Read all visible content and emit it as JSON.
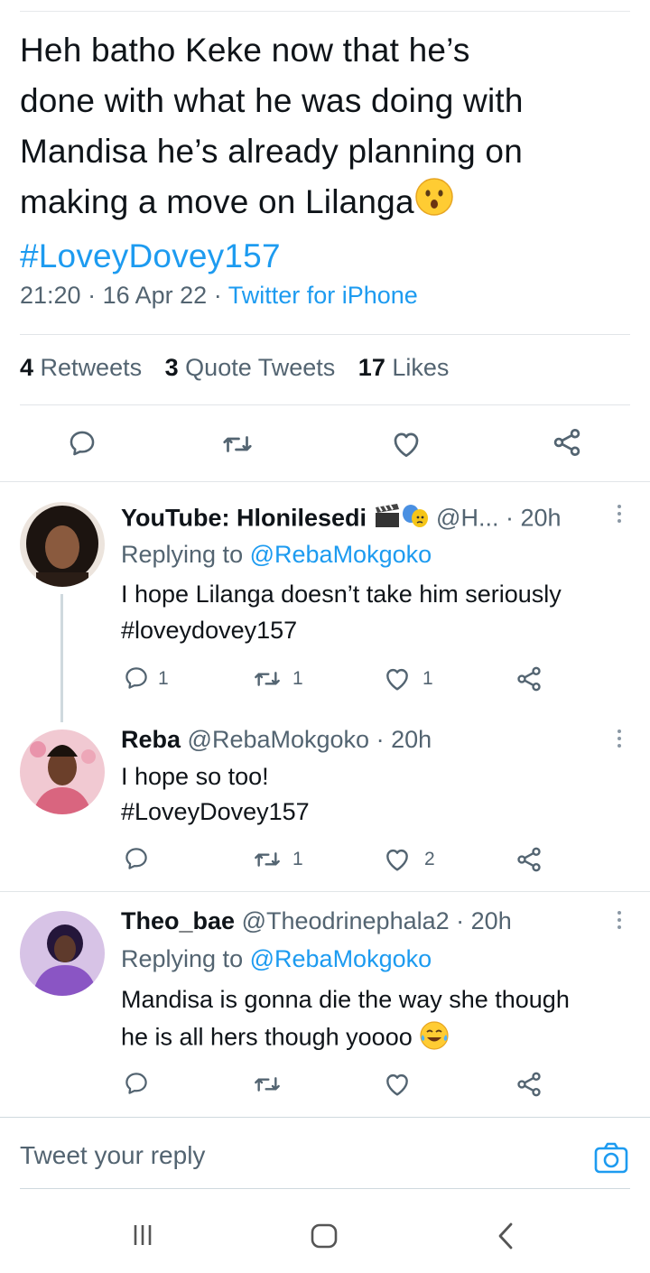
{
  "main_tweet": {
    "text_lines": [
      "Heh batho Keke now that he’s",
      "done with what he was doing with",
      "Mandisa he’s already planning on",
      "making a move on Lilanga"
    ],
    "hashtag": "#LoveyDovey157",
    "time": "21:20",
    "date": "16 Apr 22",
    "source": "Twitter for iPhone",
    "retweets_count": "4",
    "retweets_label": "Retweets",
    "quotes_count": "3",
    "quotes_label": "Quote Tweets",
    "likes_count": "17",
    "likes_label": "Likes"
  },
  "replies": [
    {
      "name": "YouTube: Hlonilesedi",
      "handle": "@H...",
      "time": "20h",
      "replying_prefix": "Replying to",
      "replying_to": "@RebaMokgoko",
      "text": "I hope Lilanga doesn’t take him seriously",
      "hashtag": "#loveydovey157",
      "reply_count": "1",
      "retweet_count": "1",
      "like_count": "1"
    },
    {
      "name": "Reba",
      "handle": "@RebaMokgoko",
      "time": "20h",
      "text": "I hope so too!",
      "hashtag": "#LoveyDovey157",
      "retweet_count": "1",
      "like_count": "2"
    },
    {
      "name": "Theo_bae",
      "handle": "@Theodrinephala2",
      "time": "20h",
      "replying_prefix": "Replying to",
      "replying_to": "@RebaMokgoko",
      "text_line1": "Mandisa is gonna die the way she though",
      "text_line2": "he is all hers though yoooo"
    }
  ],
  "compose": {
    "placeholder": "Tweet your reply"
  },
  "colors": {
    "link": "#1d9bf0",
    "secondary": "#536471",
    "text": "#0f1419"
  },
  "icons": [
    "reply-icon",
    "retweet-icon",
    "like-icon",
    "share-icon",
    "more-icon",
    "camera-icon",
    "recents-icon",
    "home-icon",
    "back-icon"
  ]
}
